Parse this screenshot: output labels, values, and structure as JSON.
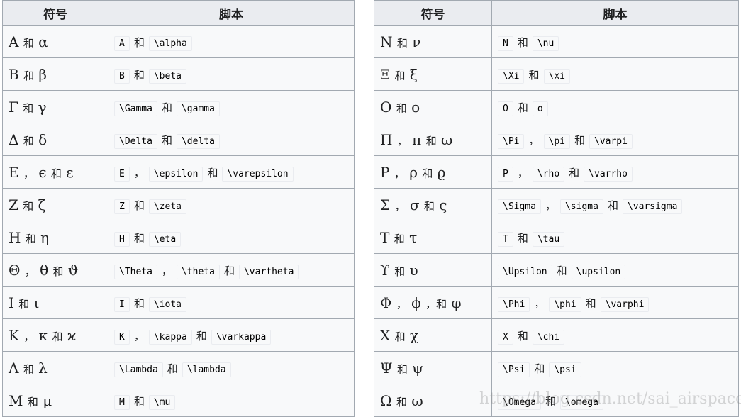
{
  "headers": {
    "symbol": "符号",
    "script": "脚本"
  },
  "left_rows": [
    {
      "symbol": "Α 和 α",
      "code": [
        "A",
        "和",
        "\\alpha"
      ]
    },
    {
      "symbol": "Β 和 β",
      "code": [
        "B",
        "和",
        "\\beta"
      ]
    },
    {
      "symbol": "Γ 和 γ",
      "code": [
        "\\Gamma",
        "和",
        "\\gamma"
      ]
    },
    {
      "symbol": "Δ 和 δ",
      "code": [
        "\\Delta",
        "和",
        "\\delta"
      ]
    },
    {
      "symbol": "Ε ， ϵ 和 ε",
      "code": [
        "E",
        "，",
        "\\epsilon",
        "和",
        "\\varepsilon"
      ]
    },
    {
      "symbol": "Ζ 和 ζ",
      "code": [
        "Z",
        "和",
        "\\zeta"
      ]
    },
    {
      "symbol": "Η 和 η",
      "code": [
        "H",
        "和",
        "\\eta"
      ]
    },
    {
      "symbol": "Θ ， θ 和 ϑ",
      "code": [
        "\\Theta",
        "，",
        "\\theta",
        "和",
        "\\vartheta"
      ]
    },
    {
      "symbol": "Ι 和 ι",
      "code": [
        "I",
        "和",
        "\\iota"
      ]
    },
    {
      "symbol": "Κ ， κ 和 ϰ",
      "code": [
        "K",
        "，",
        "\\kappa",
        "和",
        "\\varkappa"
      ]
    },
    {
      "symbol": "Λ 和 λ",
      "code": [
        "\\Lambda",
        "和",
        "\\lambda"
      ]
    },
    {
      "symbol": "Μ 和 μ",
      "code": [
        "M",
        "和",
        "\\mu"
      ]
    }
  ],
  "right_rows": [
    {
      "symbol": "Ν 和 ν",
      "code": [
        "N",
        "和",
        "\\nu"
      ]
    },
    {
      "symbol": "Ξ 和 ξ",
      "code": [
        "\\Xi",
        "和",
        "\\xi"
      ]
    },
    {
      "symbol": "Ο 和 ο",
      "code": [
        "O",
        "和",
        "o"
      ]
    },
    {
      "symbol": "Π ， π 和 ϖ",
      "code": [
        "\\Pi",
        "，",
        "\\pi",
        "和",
        "\\varpi"
      ]
    },
    {
      "symbol": "Ρ ， ρ 和 ϱ",
      "code": [
        "P",
        "，",
        "\\rho",
        "和",
        "\\varrho"
      ]
    },
    {
      "symbol": "Σ ， σ 和 ς",
      "code": [
        "\\Sigma",
        "，",
        "\\sigma",
        "和",
        "\\varsigma"
      ]
    },
    {
      "symbol": "Τ 和 τ",
      "code": [
        "T",
        "和",
        "\\tau"
      ]
    },
    {
      "symbol": "ϒ 和 υ",
      "code": [
        "\\Upsilon",
        "和",
        "\\upsilon"
      ]
    },
    {
      "symbol": "Φ ， ϕ ，和 φ",
      "code": [
        "\\Phi",
        "，",
        "\\phi",
        "和",
        "\\varphi"
      ]
    },
    {
      "symbol": "Χ 和 χ",
      "code": [
        "X",
        "和",
        "\\chi"
      ]
    },
    {
      "symbol": "Ψ 和 ψ",
      "code": [
        "\\Psi",
        "和",
        "\\psi"
      ]
    },
    {
      "symbol": "Ω 和 ω",
      "code": [
        "\\Omega",
        "和",
        "\\omega"
      ]
    }
  ],
  "watermark": "https://blog.csdn.net/sai_airspace"
}
